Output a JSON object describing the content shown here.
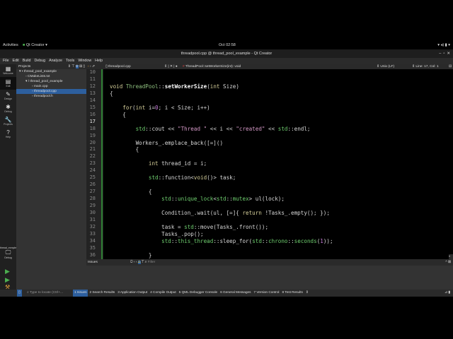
{
  "topbar": {
    "activities": "Activities",
    "app": "Qt Creator",
    "clock": "Oct 02:58"
  },
  "window": {
    "title": "threadpool.cpp @ thread_pool_example - Qt Creator"
  },
  "menu": [
    "File",
    "Edit",
    "Build",
    "Debug",
    "Analyze",
    "Tools",
    "Window",
    "Help"
  ],
  "modes": [
    {
      "label": "Welcome",
      "icon": "▦"
    },
    {
      "label": "Edit",
      "icon": "▤"
    },
    {
      "label": "Design",
      "icon": "✎"
    },
    {
      "label": "Debug",
      "icon": "✱"
    },
    {
      "label": "Projects",
      "icon": "🔧"
    },
    {
      "label": "Help",
      "icon": "?"
    }
  ],
  "projects": {
    "title": "Projects",
    "tree": [
      {
        "label": "thread_pool_example",
        "depth": 0,
        "icon": "▾ ▪"
      },
      {
        "label": "CMakeLists.txt",
        "depth": 1,
        "icon": "▫"
      },
      {
        "label": "thread_pool_example",
        "depth": 1,
        "icon": "▾ /"
      },
      {
        "label": "main.cpp",
        "depth": 2,
        "icon": "▫"
      },
      {
        "label": "threadpool.cpp",
        "depth": 2,
        "icon": "▫",
        "selected": true
      },
      {
        "label": "threadpool.h",
        "depth": 2,
        "icon": "▫"
      }
    ]
  },
  "editor": {
    "file_tab": "threadpool.cpp",
    "symbol": "ThreadPool::setWorkerSize(int): void",
    "line_ending": "Unix (LF)",
    "position": "Line: 17, Col: 1",
    "current_line": 17,
    "lines": [
      {
        "n": 10,
        "t": []
      },
      {
        "n": 11,
        "t": []
      },
      {
        "n": 12,
        "t": [
          [
            "void",
            "kw"
          ],
          [
            " "
          ],
          [
            "ThreadPool",
            "ty"
          ],
          [
            "::"
          ],
          [
            "setWorkerSize",
            "fn"
          ],
          [
            "("
          ],
          [
            "int",
            "kw"
          ],
          [
            " Size)"
          ]
        ]
      },
      {
        "n": 13,
        "t": [
          [
            "{"
          ]
        ]
      },
      {
        "n": 14,
        "t": []
      },
      {
        "n": 15,
        "t": [
          [
            "    "
          ],
          [
            "for",
            "kw"
          ],
          [
            "("
          ],
          [
            "int",
            "kw"
          ],
          [
            " i="
          ],
          [
            "0",
            "nm"
          ],
          [
            "; i < Size; i++)"
          ]
        ]
      },
      {
        "n": 16,
        "t": [
          [
            "    {"
          ]
        ]
      },
      {
        "n": 17,
        "t": []
      },
      {
        "n": 18,
        "t": [
          [
            "        "
          ],
          [
            "std",
            "ns"
          ],
          [
            "::cout << "
          ],
          [
            "\"Thread \"",
            "st"
          ],
          [
            " << i << "
          ],
          [
            "\"created\"",
            "st"
          ],
          [
            " << "
          ],
          [
            "std",
            "ns"
          ],
          [
            "::endl;"
          ]
        ]
      },
      {
        "n": 19,
        "t": []
      },
      {
        "n": 20,
        "t": [
          [
            "        Workers_.emplace_back([=]()"
          ]
        ]
      },
      {
        "n": 21,
        "t": [
          [
            "        {"
          ]
        ]
      },
      {
        "n": 22,
        "t": []
      },
      {
        "n": 23,
        "t": [
          [
            "            "
          ],
          [
            "int",
            "kw"
          ],
          [
            " thread_id = i;"
          ]
        ]
      },
      {
        "n": 24,
        "t": []
      },
      {
        "n": 25,
        "t": [
          [
            "            "
          ],
          [
            "std",
            "ns"
          ],
          [
            "::function<"
          ],
          [
            "void",
            "kw"
          ],
          [
            "()> task;"
          ]
        ]
      },
      {
        "n": 26,
        "t": []
      },
      {
        "n": 27,
        "t": [
          [
            "            {"
          ]
        ]
      },
      {
        "n": 28,
        "t": [
          [
            "                "
          ],
          [
            "std",
            "ns"
          ],
          [
            "::"
          ],
          [
            "unique_lock",
            "ns"
          ],
          [
            "<"
          ],
          [
            "std",
            "ns"
          ],
          [
            "::"
          ],
          [
            "mutex",
            "ns"
          ],
          [
            "> ul(lock);"
          ]
        ]
      },
      {
        "n": 29,
        "t": []
      },
      {
        "n": 30,
        "t": [
          [
            "                Condition_.wait(ul, [=]{ "
          ],
          [
            "return",
            "kw"
          ],
          [
            " !Tasks_.empty(); });"
          ]
        ]
      },
      {
        "n": 31,
        "t": []
      },
      {
        "n": 32,
        "t": [
          [
            "                task = "
          ],
          [
            "std",
            "ns"
          ],
          [
            "::move(Tasks_.front());"
          ]
        ]
      },
      {
        "n": 33,
        "t": [
          [
            "                Tasks_.pop();"
          ]
        ]
      },
      {
        "n": 34,
        "t": [
          [
            "                "
          ],
          [
            "std",
            "ns"
          ],
          [
            "::"
          ],
          [
            "this_thread",
            "ns"
          ],
          [
            "::sleep_for("
          ],
          [
            "std",
            "ns"
          ],
          [
            "::"
          ],
          [
            "chrono",
            "ns"
          ],
          [
            "::"
          ],
          [
            "seconds",
            "ns"
          ],
          [
            "("
          ],
          [
            "1",
            "nm"
          ],
          [
            "));"
          ]
        ]
      },
      {
        "n": 35,
        "t": []
      },
      {
        "n": 36,
        "t": [
          [
            "            }"
          ]
        ]
      }
    ]
  },
  "kit": {
    "name": "thread_exmple",
    "mode": "Debug"
  },
  "issues": {
    "title": "Issues",
    "filter_placeholder": "Filter"
  },
  "status": {
    "locate_placeholder": "Type to locate (Ctrl+...",
    "tabs": [
      "1 Issues",
      "2 Search Results",
      "3 Application Output",
      "4 Compile Output",
      "5 QML Debugger Console",
      "6 General Messages",
      "7 Version Control",
      "8 Test Results"
    ],
    "more": "⇕"
  }
}
